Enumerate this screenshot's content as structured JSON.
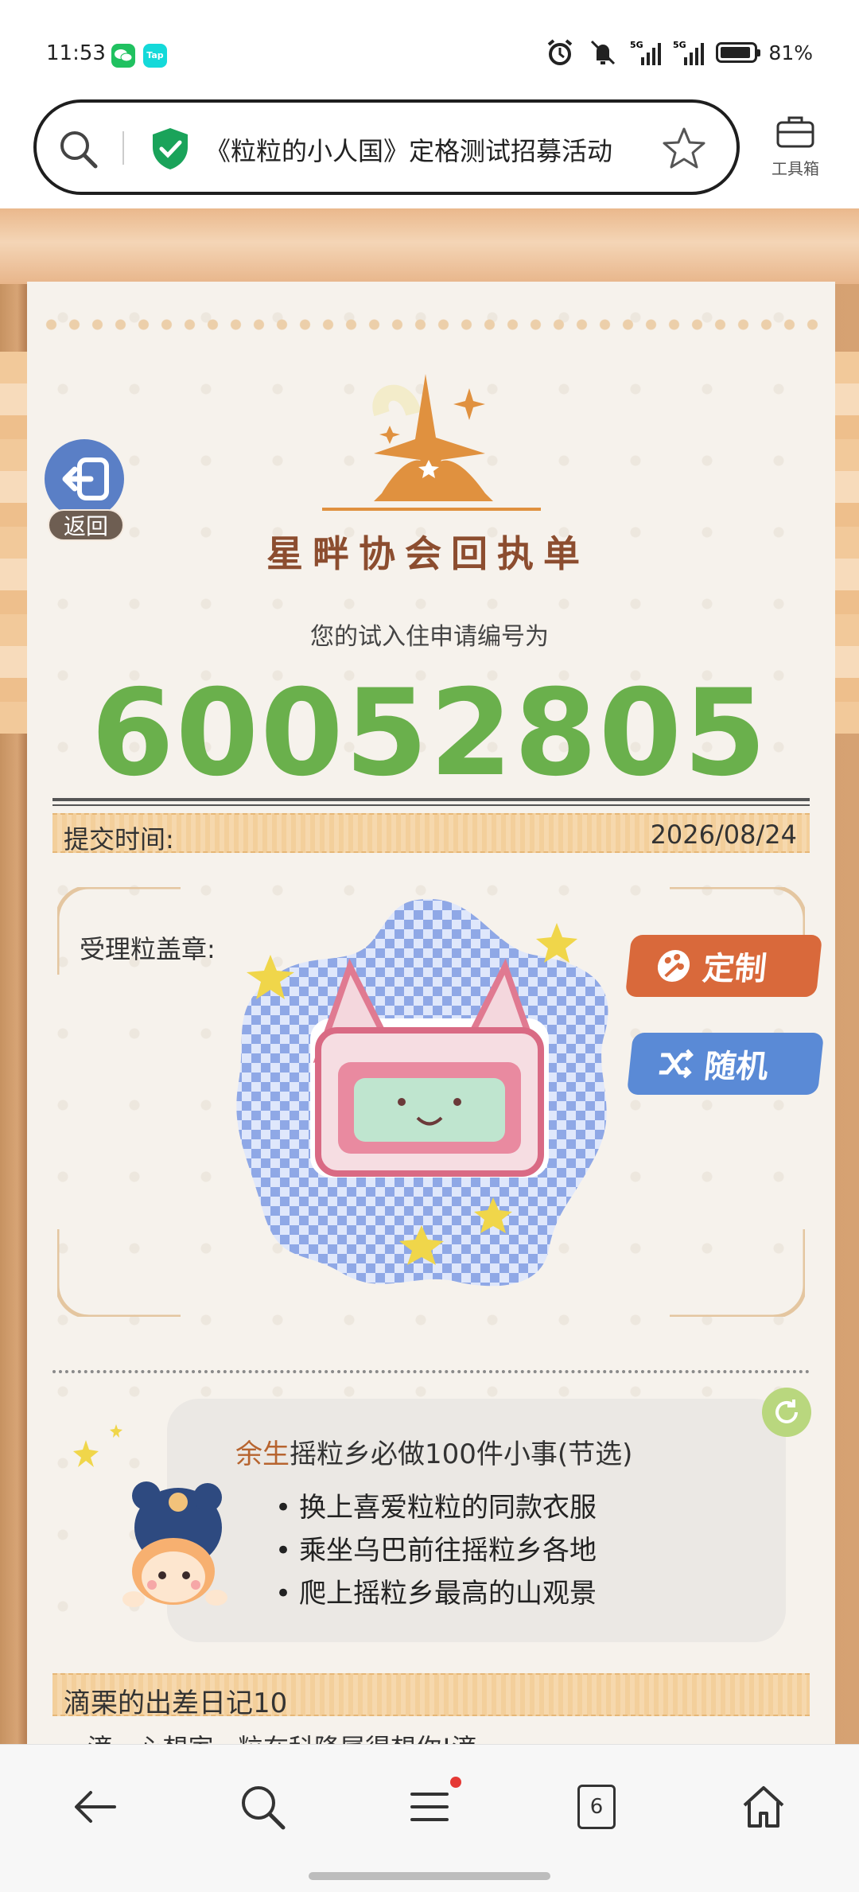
{
  "status_bar": {
    "time": "11:53",
    "apps": [
      {
        "name": "wechat-icon",
        "color": "#20c160",
        "text": ""
      },
      {
        "name": "taptap-icon",
        "color": "#14d9d9",
        "text": "Tap"
      }
    ],
    "battery_percent": 81,
    "battery_text": "81%"
  },
  "address_bar": {
    "title": "《粒粒的小人国》定格测试招募活动",
    "secure": true,
    "toolbox_label": "工具箱"
  },
  "page": {
    "back_label": "返回",
    "logo_title": "星畔协会回执单",
    "apply_label": "您的试入住申请编号为",
    "apply_number": "60052805",
    "submit_time_label": "提交时间:",
    "submit_time_value": "2026/08/24",
    "stamp_label": "受理粒盖章:",
    "custom_button": "定制",
    "random_button": "随机",
    "things": {
      "title_highlight": "余生",
      "title_rest": "摇粒乡必做100件小事(节选)",
      "items": [
        "换上喜爱粒粒的同款衣服",
        "乘坐乌巴前往摇粒乡各地",
        "爬上摇粒乡最高的山观景"
      ]
    },
    "diary_title": "滴栗的出差日记10",
    "diary_preview": "滴...心想家...粒在科隆属得想你!滴"
  },
  "bottom_nav": {
    "tab_count": "6",
    "has_notification": true
  },
  "colors": {
    "accent_green": "#6ab04c",
    "custom_orange": "#d9693b",
    "random_blue": "#5a8ad6",
    "back_blue": "#5a7fc6"
  }
}
